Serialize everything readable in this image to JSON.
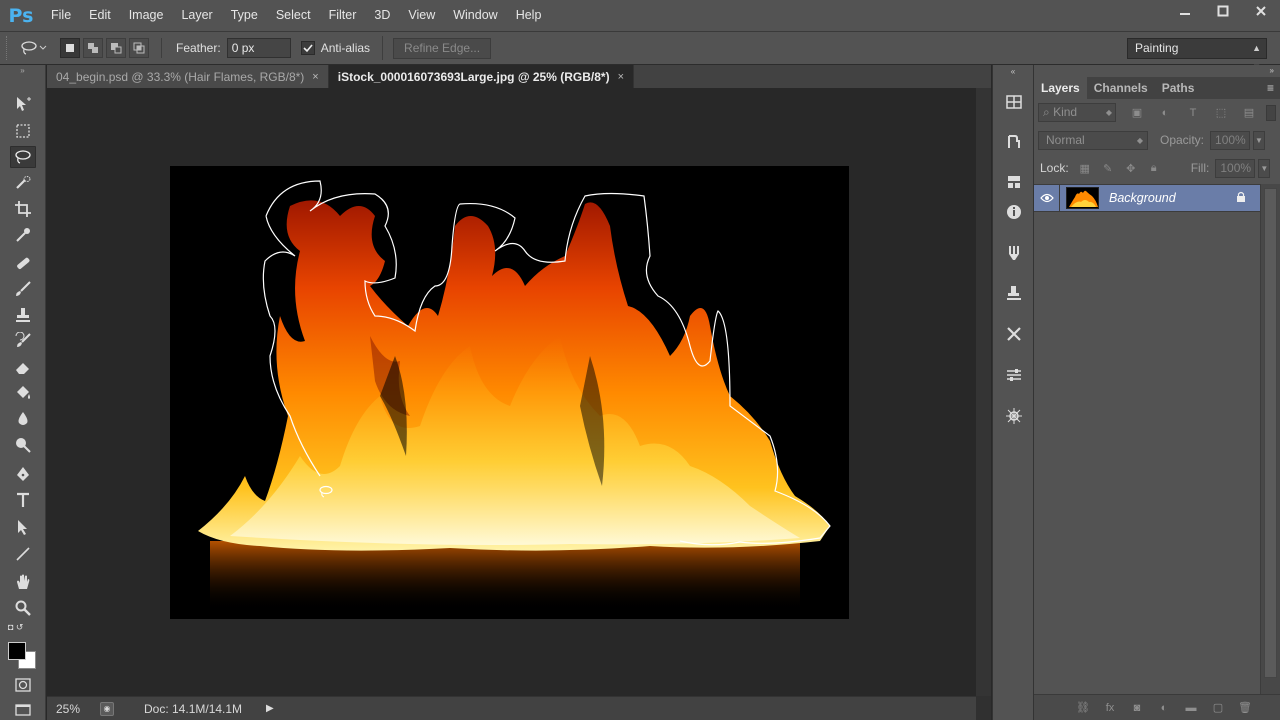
{
  "app": {
    "logo": "Ps"
  },
  "menu": [
    "File",
    "Edit",
    "Image",
    "Layer",
    "Type",
    "Select",
    "Filter",
    "3D",
    "View",
    "Window",
    "Help"
  ],
  "window_controls": {
    "minimize": "—",
    "maximize": "□",
    "close": "✕"
  },
  "options": {
    "active_tool_icon": "lasso-icon",
    "feather_label": "Feather:",
    "feather_value": "0 px",
    "antialias_label": "Anti-alias",
    "antialias_checked": true,
    "refine_edge_label": "Refine Edge...",
    "workspace": "Painting"
  },
  "tabs": [
    {
      "label": "04_begin.psd @ 33.3% (Hair Flames, RGB/8*)",
      "close": "×",
      "active": false
    },
    {
      "label": "iStock_000016073693Large.jpg @ 25% (RGB/8*)",
      "close": "×",
      "active": true
    }
  ],
  "toolbar": {
    "tools": [
      "move-tool-icon",
      "marquee-tool-icon",
      "lasso-tool-icon",
      "quick-selection-tool-icon",
      "crop-tool-icon",
      "eyedropper-tool-icon",
      "healing-brush-tool-icon",
      "brush-tool-icon",
      "clone-stamp-tool-icon",
      "history-brush-tool-icon",
      "eraser-tool-icon",
      "paint-bucket-tool-icon",
      "blur-tool-icon",
      "dodge-tool-icon",
      "pen-tool-icon",
      "type-tool-icon",
      "path-selection-tool-icon",
      "line-tool-icon",
      "hand-tool-icon",
      "zoom-tool-icon"
    ],
    "active_tool": "lasso-tool-icon",
    "foreground_color": "#000000",
    "background_color": "#ffffff"
  },
  "status": {
    "zoom": "25%",
    "doc": "Doc: 14.1M/14.1M"
  },
  "dock_icons": [
    "swatches-grid-icon",
    "history-icon",
    "adjustments-icon",
    "info-icon",
    "brushes-icon",
    "clone-source-icon",
    "tools-presets-icon",
    "properties-icon",
    "3d-icon"
  ],
  "layers_panel": {
    "tabs": [
      "Layers",
      "Channels",
      "Paths"
    ],
    "active_tab": "Layers",
    "kind_label": "Kind",
    "blend_mode": "Normal",
    "opacity_label": "Opacity:",
    "opacity_value": "100%",
    "lock_label": "Lock:",
    "fill_label": "Fill:",
    "fill_value": "100%",
    "layers": [
      {
        "name": "Background",
        "visible": true,
        "locked": true,
        "selected": true
      }
    ],
    "selected_color": "#6a7da8"
  },
  "colors": {
    "accent": "#4bb3f0",
    "ui_bg": "#535353",
    "canvas_bg": "#282828"
  }
}
